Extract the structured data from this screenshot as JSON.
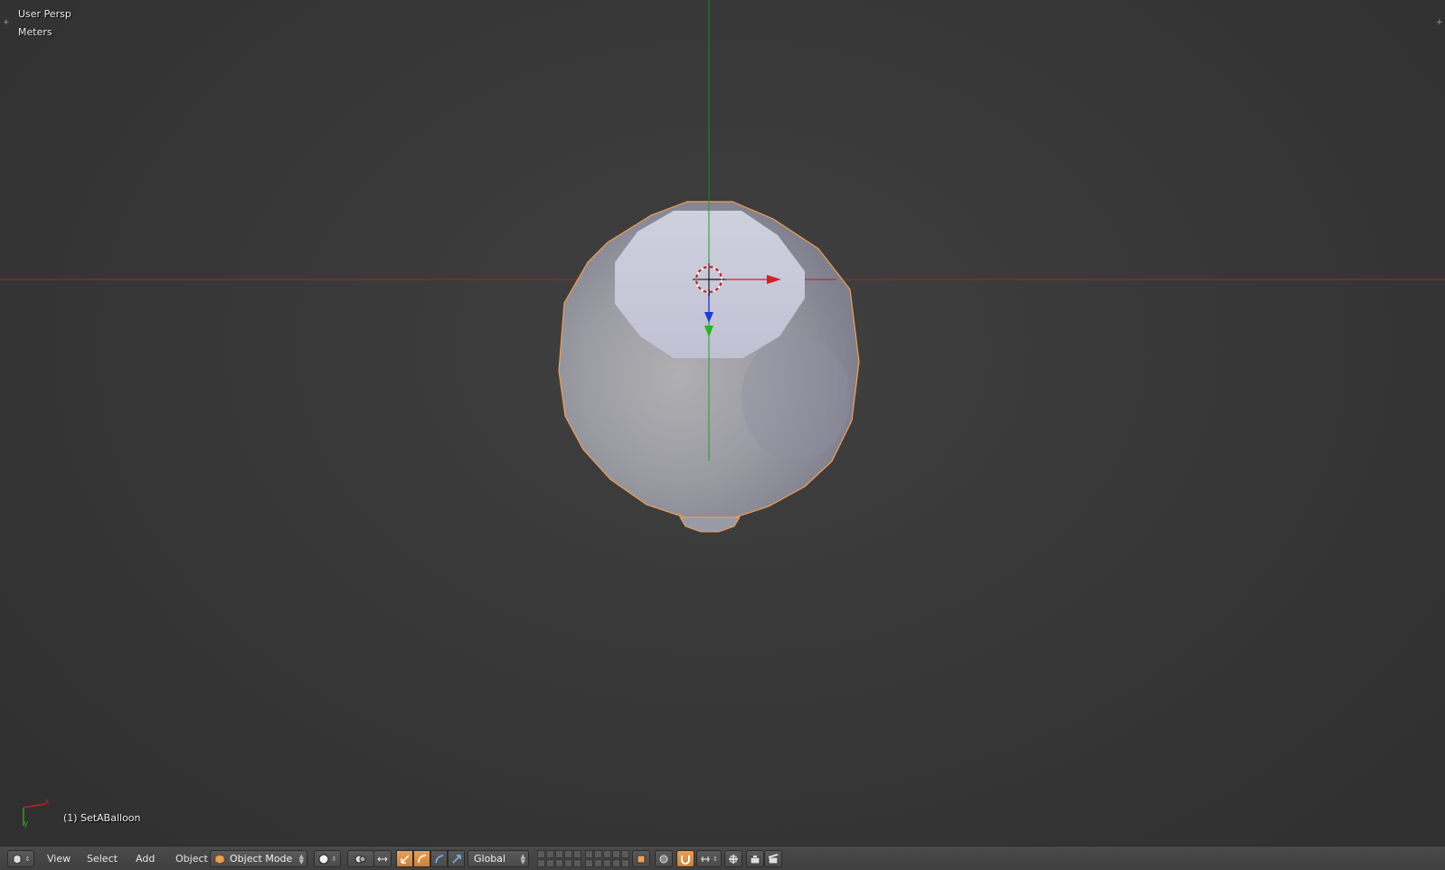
{
  "viewport": {
    "view_name": "User Persp",
    "units": "Meters",
    "active_object": "(1) SetABalloon",
    "axis_gizmo": {
      "x_label": "x",
      "y_label": "y"
    },
    "colors": {
      "x_axis": "#c81e1e",
      "y_axis": "#1e9a1e",
      "z_axis": "#1f3ad6",
      "selection_outline": "#f0a050",
      "background": "#393939"
    }
  },
  "header": {
    "editor_type_icon": "3d-view-icon",
    "menus": [
      "View",
      "Select",
      "Add",
      "Object"
    ],
    "mode": "Object Mode",
    "viewport_shading_icon": "solid-sphere-icon",
    "pivot_icon": "pivot-point-icon",
    "manipulator_icons": [
      "translate-icon",
      "rotate-icon",
      "scale-icon"
    ],
    "transform_orientation": "Global",
    "layers_count": 20,
    "snap_icon": "magnet-icon",
    "render_icons": [
      "camera-icon",
      "clapperboard-icon"
    ]
  }
}
